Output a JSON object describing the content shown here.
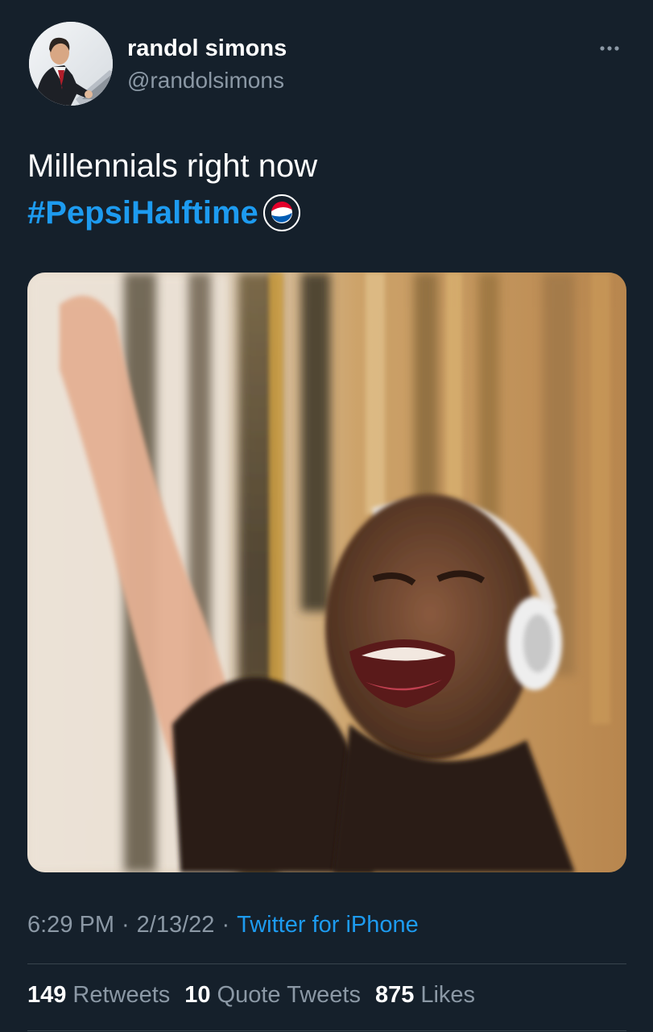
{
  "user": {
    "display_name": "randol simons",
    "handle": "@randolsimons"
  },
  "header": {
    "more_icon": "more-horizontal-icon"
  },
  "tweet": {
    "text": "Millennials right now",
    "hashtag": "#PepsiHalftime",
    "hashflag_icon": "pepsi-logo-icon"
  },
  "media": {
    "type": "photo"
  },
  "meta": {
    "time": "6:29 PM",
    "separator": "·",
    "date": "2/13/22",
    "source": "Twitter for iPhone"
  },
  "stats": {
    "retweets_count": "149",
    "retweets_label": "Retweets",
    "quotes_count": "10",
    "quotes_label": "Quote Tweets",
    "likes_count": "875",
    "likes_label": "Likes"
  },
  "colors": {
    "background": "#15202b",
    "accent": "#1d9bf0",
    "secondary_text": "#8b98a5",
    "divider": "#38444d"
  }
}
